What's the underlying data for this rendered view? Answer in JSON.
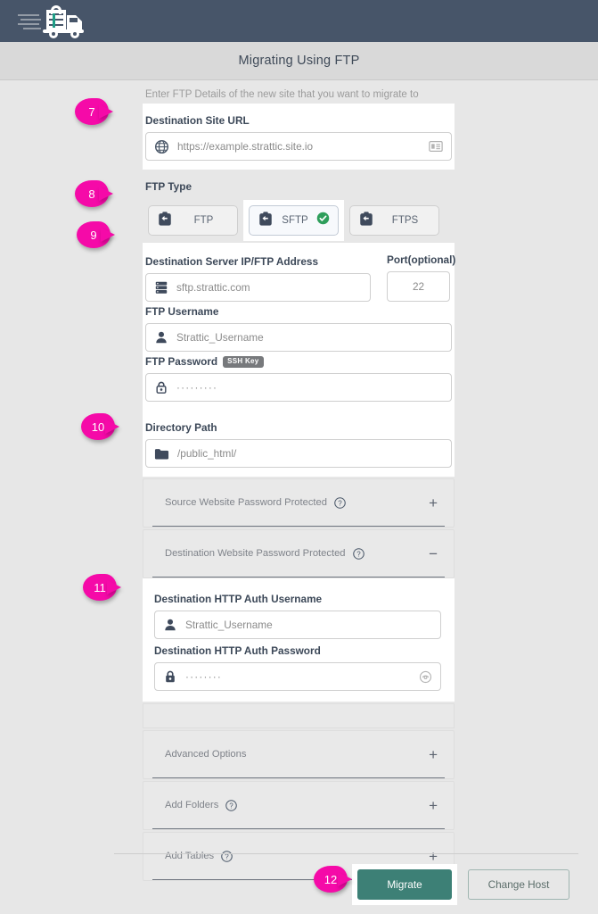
{
  "header": {
    "logo_icon": "moving-truck-lock-logo",
    "title": "Migrating Using FTP"
  },
  "form": {
    "hint": "Enter FTP Details of the new site that you want to migrate to",
    "destination_url": {
      "label": "Destination Site URL",
      "value": "https://example.strattic.site.io",
      "left_icon": "globe-icon",
      "right_icon": "id-card-icon"
    },
    "ftp_type": {
      "label": "FTP Type",
      "options": [
        {
          "label": "FTP",
          "icon": "ftp-upload-icon",
          "selected": false
        },
        {
          "label": "SFTP",
          "icon": "ftp-upload-icon",
          "selected": true
        },
        {
          "label": "FTPS",
          "icon": "ftp-upload-icon",
          "selected": false
        }
      ],
      "selected": "SFTP",
      "check_icon": "green-check-icon",
      "check_color": "#2e9e5b"
    },
    "server": {
      "label": "Destination Server IP/FTP Address",
      "value": "sftp.strattic.com",
      "left_icon": "server-icon"
    },
    "port": {
      "label": "Port(optional)",
      "value": "22"
    },
    "ftp_username": {
      "label": "FTP Username",
      "value": "Strattic_Username",
      "left_icon": "user-icon"
    },
    "ftp_password": {
      "label": "FTP Password",
      "badge": "SSH Key",
      "value": "·········",
      "left_icon": "lock-icon"
    },
    "directory_path": {
      "label": "Directory Path",
      "value": "/public_html/",
      "left_icon": "folder-icon"
    }
  },
  "accordions": [
    {
      "label": "Source Website Password Protected",
      "help": true,
      "sign": "+",
      "expanded": false
    },
    {
      "label": "Destination Website Password Protected",
      "help": true,
      "sign": "−",
      "expanded": true
    },
    {
      "label": "Advanced Options",
      "help": false,
      "sign": "+",
      "expanded": false
    },
    {
      "label": "Add Folders",
      "help": true,
      "sign": "+",
      "expanded": false
    },
    {
      "label": "Add Tables",
      "help": true,
      "sign": "+",
      "expanded": false
    }
  ],
  "http_auth": {
    "username": {
      "label": "Destination HTTP Auth Username",
      "value": "Strattic_Username",
      "left_icon": "user-icon"
    },
    "password": {
      "label": "Destination HTTP Auth Password",
      "value": "········",
      "left_icon": "lock-icon",
      "right_icon": "eye-reveal-icon"
    }
  },
  "footer": {
    "migrate_label": "Migrate",
    "change_host_label": "Change Host",
    "primary_color": "#3d8076"
  },
  "markers": [
    {
      "number": "7"
    },
    {
      "number": "8"
    },
    {
      "number": "9"
    },
    {
      "number": "10"
    },
    {
      "number": "11"
    },
    {
      "number": "12"
    }
  ]
}
